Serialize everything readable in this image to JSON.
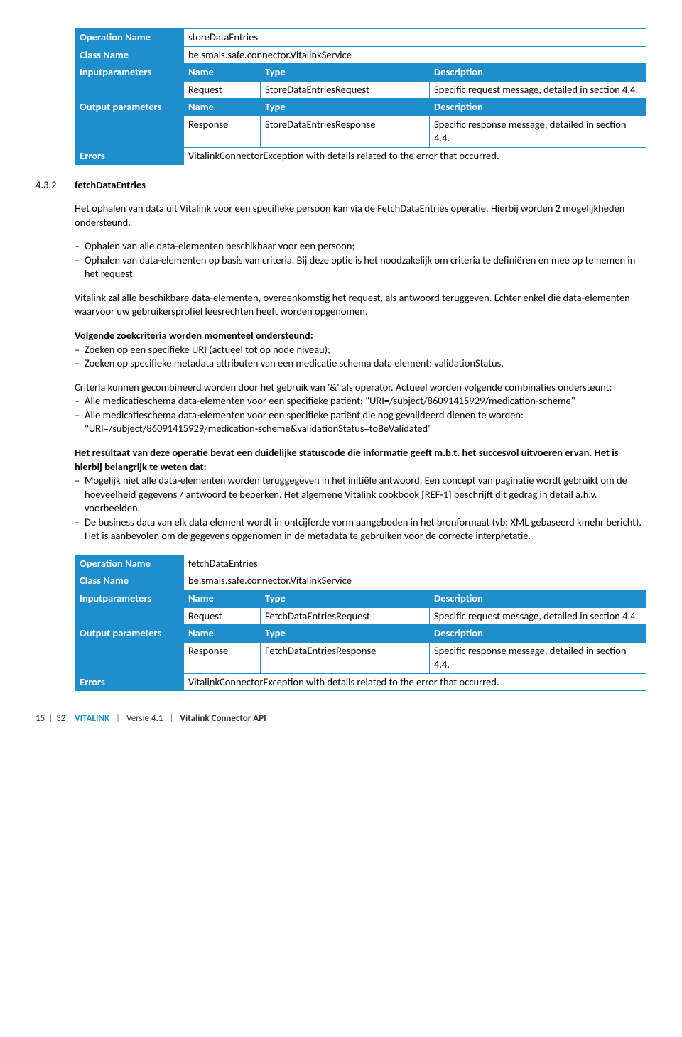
{
  "table1": {
    "op_label": "Operation Name",
    "op_val": "storeDataEntries",
    "class_label": "Class Name",
    "class_val": "be.smals.safe.connector.VitalinkService",
    "input_label": "Inputparameters",
    "name_h": "Name",
    "type_h": "Type",
    "desc_h": "Description",
    "in_name": "Request",
    "in_type": "StoreDataEntriesRequest",
    "in_desc": "Specific request message, detailed in section 4.4.",
    "output_label": "Output parameters",
    "out_name": "Response",
    "out_type": "StoreDataEntriesResponse",
    "out_desc": "Specific response message, detailed in section 4.4.",
    "errors_label": "Errors",
    "errors_val": "VitalinkConnectorException with details related to the error that occurred."
  },
  "sec": {
    "num": "4.3.2",
    "title": "fetchDataEntries"
  },
  "body": {
    "p1": "Het ophalen van data uit Vitalink voor een specifieke persoon kan via de FetchDataEntries operatie. Hierbij worden 2 mogelijkheden ondersteund:",
    "b1a": "Ophalen van alle data-elementen beschikbaar voor een persoon;",
    "b1b": "Ophalen van data-elementen op basis van criteria. Bij deze optie is het noodzakelijk om criteria te definiëren en mee op te nemen in het request.",
    "p2": "Vitalink zal alle beschikbare data-elementen, overeenkomstig het request, als antwoord teruggeven. Echter enkel die data-elementen waarvoor uw gebruikersprofiel leesrechten heeft worden opgenomen.",
    "p3_bold": "Volgende zoekcriteria worden momenteel ondersteund:",
    "b3a": "Zoeken op een specifieke URI (actueel tot op node niveau);",
    "b3b": "Zoeken op specifieke metadata attributen van een medicatie schema data element: validationStatus.",
    "p4": "Criteria kunnen gecombineerd worden door het gebruik van '&' als operator. Actueel worden volgende combinaties ondersteunt:",
    "b4a": "Alle medicatieschema data-elementen voor een specifieke patiënt: \"URI=/subject/86091415929/medication-scheme\"",
    "b4b": "Alle medicatieschema data-elementen voor een specifieke patiënt die nog gevalideerd dienen te worden: \"URI=/subject/86091415929/medication-scheme&validationStatus=toBeValidated\"",
    "p5_bold": "Het resultaat van deze operatie bevat een duidelijke statuscode die informatie geeft m.b.t. het succesvol uitvoeren ervan. Het is hierbij belangrijk te weten dat:",
    "b5a": "Mogelijk niet alle data-elementen worden teruggegeven in het initiële antwoord. Een concept van paginatie wordt gebruikt om de hoeveelheid gegevens / antwoord te beperken. Het algemene Vitalink cookbook [REF-1] beschrijft dit gedrag in detail a.h.v. voorbeelden.",
    "b5b": "De business data van elk data element wordt in ontcijferde vorm aangeboden in het bronformaat (vb: XML gebaseerd kmehr bericht). Het is aanbevolen om de gegevens opgenomen in de metadata te gebruiken voor de correcte interpretatie."
  },
  "table2": {
    "op_label": "Operation Name",
    "op_val": "fetchDataEntries",
    "class_label": "Class Name",
    "class_val": "be.smals.safe.connector.VitalinkService",
    "input_label": "Inputparameters",
    "name_h": "Name",
    "type_h": "Type",
    "desc_h": "Description",
    "in_name": "Request",
    "in_type": "FetchDataEntriesRequest",
    "in_desc": "Specific request message, detailed in section 4.4.",
    "output_label": "Output parameters",
    "out_name": "Response",
    "out_type": "FetchDataEntriesResponse",
    "out_desc": "Specific response message, detailed in section 4.4.",
    "errors_label": "Errors",
    "errors_val": "VitalinkConnectorException with details related to the error that occurred."
  },
  "footer": {
    "page": "15",
    "sep": "|",
    "total": "32",
    "brand": "VITALINK",
    "version": "Versie 4.1",
    "doc": "Vitalink Connector API"
  }
}
